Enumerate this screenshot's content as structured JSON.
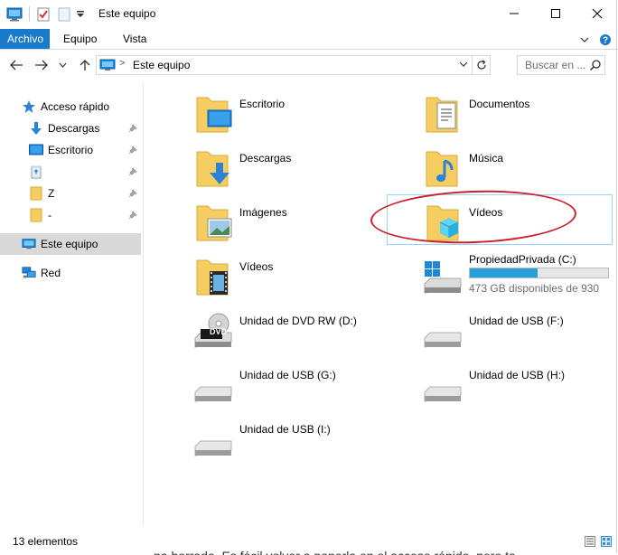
{
  "window": {
    "title": "Este equipo",
    "controls": {
      "minimize": "–",
      "maximize": "☐",
      "close": "✕"
    }
  },
  "ribbon": {
    "tabs": [
      {
        "label": "Archivo",
        "active": true
      },
      {
        "label": "Equipo",
        "active": false
      },
      {
        "label": "Vista",
        "active": false
      }
    ],
    "expand_glyph": "⌄",
    "help_glyph": "?"
  },
  "address": {
    "separator": ">",
    "path": "Este equipo",
    "dropdown": "⌄",
    "search_placeholder": "Buscar en ..."
  },
  "nav_pane": {
    "quick_access": "Acceso rápido",
    "items": [
      {
        "label": "Descargas",
        "icon": "download-icon",
        "pinned": true
      },
      {
        "label": "Escritorio",
        "icon": "desktop-icon",
        "pinned": true
      },
      {
        "label": "",
        "icon": "recycle-bin-icon",
        "pinned": true
      },
      {
        "label": "Z",
        "icon": "folder-icon",
        "pinned": true
      },
      {
        "label": "-",
        "icon": "folder-icon",
        "pinned": true
      }
    ],
    "this_pc": "Este equipo",
    "network": "Red"
  },
  "content": {
    "folders": [
      {
        "label": "Escritorio",
        "icon": "desktop-folder-icon"
      },
      {
        "label": "Documentos",
        "icon": "documents-folder-icon"
      },
      {
        "label": "Descargas",
        "icon": "downloads-folder-icon"
      },
      {
        "label": "Música",
        "icon": "music-folder-icon"
      },
      {
        "label": "Imágenes",
        "icon": "pictures-folder-icon"
      },
      {
        "label": "Vídeos",
        "icon": "3d-objects-folder-icon"
      },
      {
        "label": "Vídeos",
        "icon": "videos-folder-icon"
      }
    ],
    "drives": [
      {
        "label": "PropiedadPrivada (C:)",
        "free_text": "473 GB disponibles de 930",
        "used_fraction": 0.49
      },
      {
        "label": "Unidad de DVD RW (D:)",
        "badge": "DVD"
      },
      {
        "label": "Unidad de USB (F:)"
      },
      {
        "label": "Unidad de USB (G:)"
      },
      {
        "label": "Unidad de USB (H:)"
      },
      {
        "label": "Unidad de USB (I:)"
      }
    ]
  },
  "status": {
    "count": "13 elementos"
  },
  "colors": {
    "accent": "#1979ca",
    "folder": "#f5cd61",
    "annotation": "#cc1f2a",
    "drive_fill": "#26a0da"
  },
  "overflow_text": "na borrado. Es fácil volver a ponerla en el acceso rápido, pero ta"
}
